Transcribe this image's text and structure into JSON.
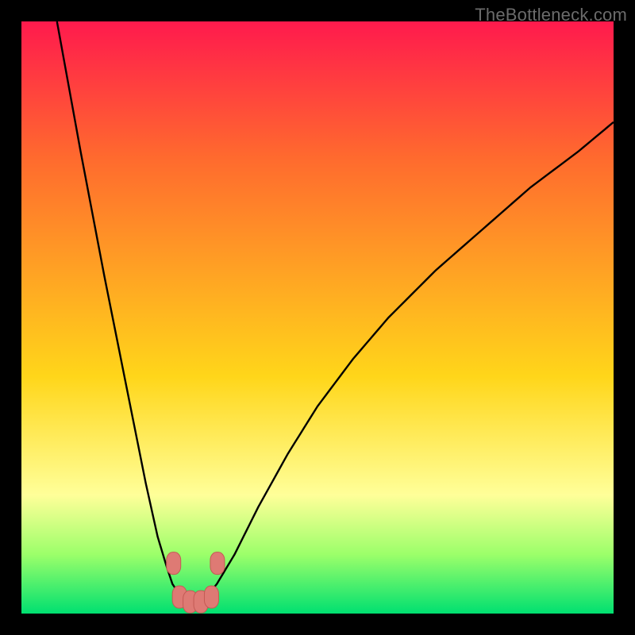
{
  "watermark": "TheBottleneck.com",
  "colors": {
    "gradient_top": "#ff1a4d",
    "gradient_mid_upper": "#ff6a2e",
    "gradient_mid": "#ffd61a",
    "gradient_band_light": "#ffff99",
    "gradient_lower_green_light": "#9cff6a",
    "gradient_bottom": "#00e070",
    "curve": "#000000",
    "marker_fill": "#de7a74",
    "marker_stroke": "#c45a54"
  },
  "chart_data": {
    "type": "line",
    "title": "",
    "xlabel": "",
    "ylabel": "",
    "xlim": [
      0,
      100
    ],
    "ylim": [
      0,
      100
    ],
    "notes": "Bottleneck-style curve: % mismatch vs. some x parameter. Minimum (~0%) around x≈27–32. Left branch rises steeply to ~100% at x≈6; right branch rises with diminishing slope to ~83% at x=100. Background vertical gradient encodes severity (red=top/high, green=bottom/low). Six salmon markers sit at the bottom of the valley.",
    "left_branch": {
      "x": [
        6,
        10,
        14,
        18,
        21,
        23,
        24.5,
        25.5,
        26.5,
        27.5
      ],
      "y": [
        100,
        78,
        57,
        37,
        22,
        13,
        8,
        5,
        3.5,
        2.5
      ]
    },
    "right_branch": {
      "x": [
        31,
        33,
        36,
        40,
        45,
        50,
        56,
        62,
        70,
        78,
        86,
        94,
        100
      ],
      "y": [
        2.5,
        5,
        10,
        18,
        27,
        35,
        43,
        50,
        58,
        65,
        72,
        78,
        83
      ]
    },
    "markers": [
      {
        "x": 25.7,
        "y": 8.5
      },
      {
        "x": 26.7,
        "y": 2.8
      },
      {
        "x": 28.5,
        "y": 2.0
      },
      {
        "x": 30.3,
        "y": 2.0
      },
      {
        "x": 32.1,
        "y": 2.8
      },
      {
        "x": 33.1,
        "y": 8.5
      }
    ]
  }
}
